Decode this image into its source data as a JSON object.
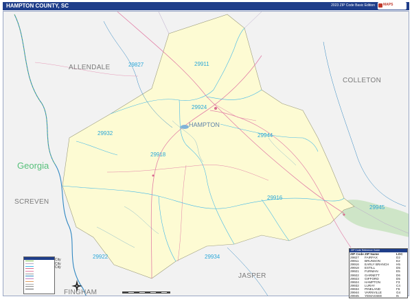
{
  "header": {
    "title": "HAMPTON COUNTY, SC",
    "edition": "2023 ZIP Code Basic Edition",
    "logo_text": "MAPS",
    "brand_color": "#1f3e8a"
  },
  "map": {
    "regions": {
      "allendale": "ALLENDALE",
      "colleton": "COLLETON",
      "screven": "SCREVEN",
      "jasper": "JASPER",
      "fingham": "FINGHAM"
    },
    "state_label": "Georgia",
    "town_label": "HAMPTON",
    "zip_labels": {
      "z29827": "29827",
      "z29911": "29911",
      "z29924": "29924",
      "z29932": "29932",
      "z29944": "29944",
      "z29918": "29918",
      "z29916": "29916",
      "z29945": "29945",
      "z29922": "29922",
      "z29934": "29934"
    },
    "colors": {
      "county_fill": "#fdfbd3",
      "outside_fill": "#f2f2f2",
      "zip_boundary": "#3fb7e8",
      "roads": "#e27fa6",
      "water": "#2e86c1",
      "wetland": "#8ac08a"
    }
  },
  "zip_table": {
    "title": "ZIP Code Reference Guide",
    "headers": {
      "zip": "ZIP Code",
      "name": "ZIP Name",
      "loc": "LOC"
    },
    "rows": [
      {
        "zip": "29827",
        "name": "FAIRFAX",
        "loc": "D2"
      },
      {
        "zip": "29911",
        "name": "BRUNSON",
        "loc": "E2"
      },
      {
        "zip": "29916",
        "name": "EARLY BRANCH",
        "loc": "H5"
      },
      {
        "zip": "29918",
        "name": "ESTILL",
        "loc": "D5"
      },
      {
        "zip": "29921",
        "name": "FURMAN",
        "loc": "E5"
      },
      {
        "zip": "29922",
        "name": "GARNETT",
        "loc": "D6"
      },
      {
        "zip": "29923",
        "name": "GIFFORD",
        "loc": "D5"
      },
      {
        "zip": "29924",
        "name": "HAMPTON",
        "loc": "F3"
      },
      {
        "zip": "29932",
        "name": "LURAY",
        "loc": "C4"
      },
      {
        "zip": "29934",
        "name": "PINELAND",
        "loc": "F6"
      },
      {
        "zip": "29944",
        "name": "VARNVILLE",
        "loc": "G4"
      },
      {
        "zip": "29945",
        "name": "YEMASSEE",
        "loc": "I5"
      }
    ]
  },
  "legend": {
    "city_label_1": "City",
    "city_label_2": "City",
    "city_label_3": "City"
  },
  "compass": {
    "north": "N"
  }
}
